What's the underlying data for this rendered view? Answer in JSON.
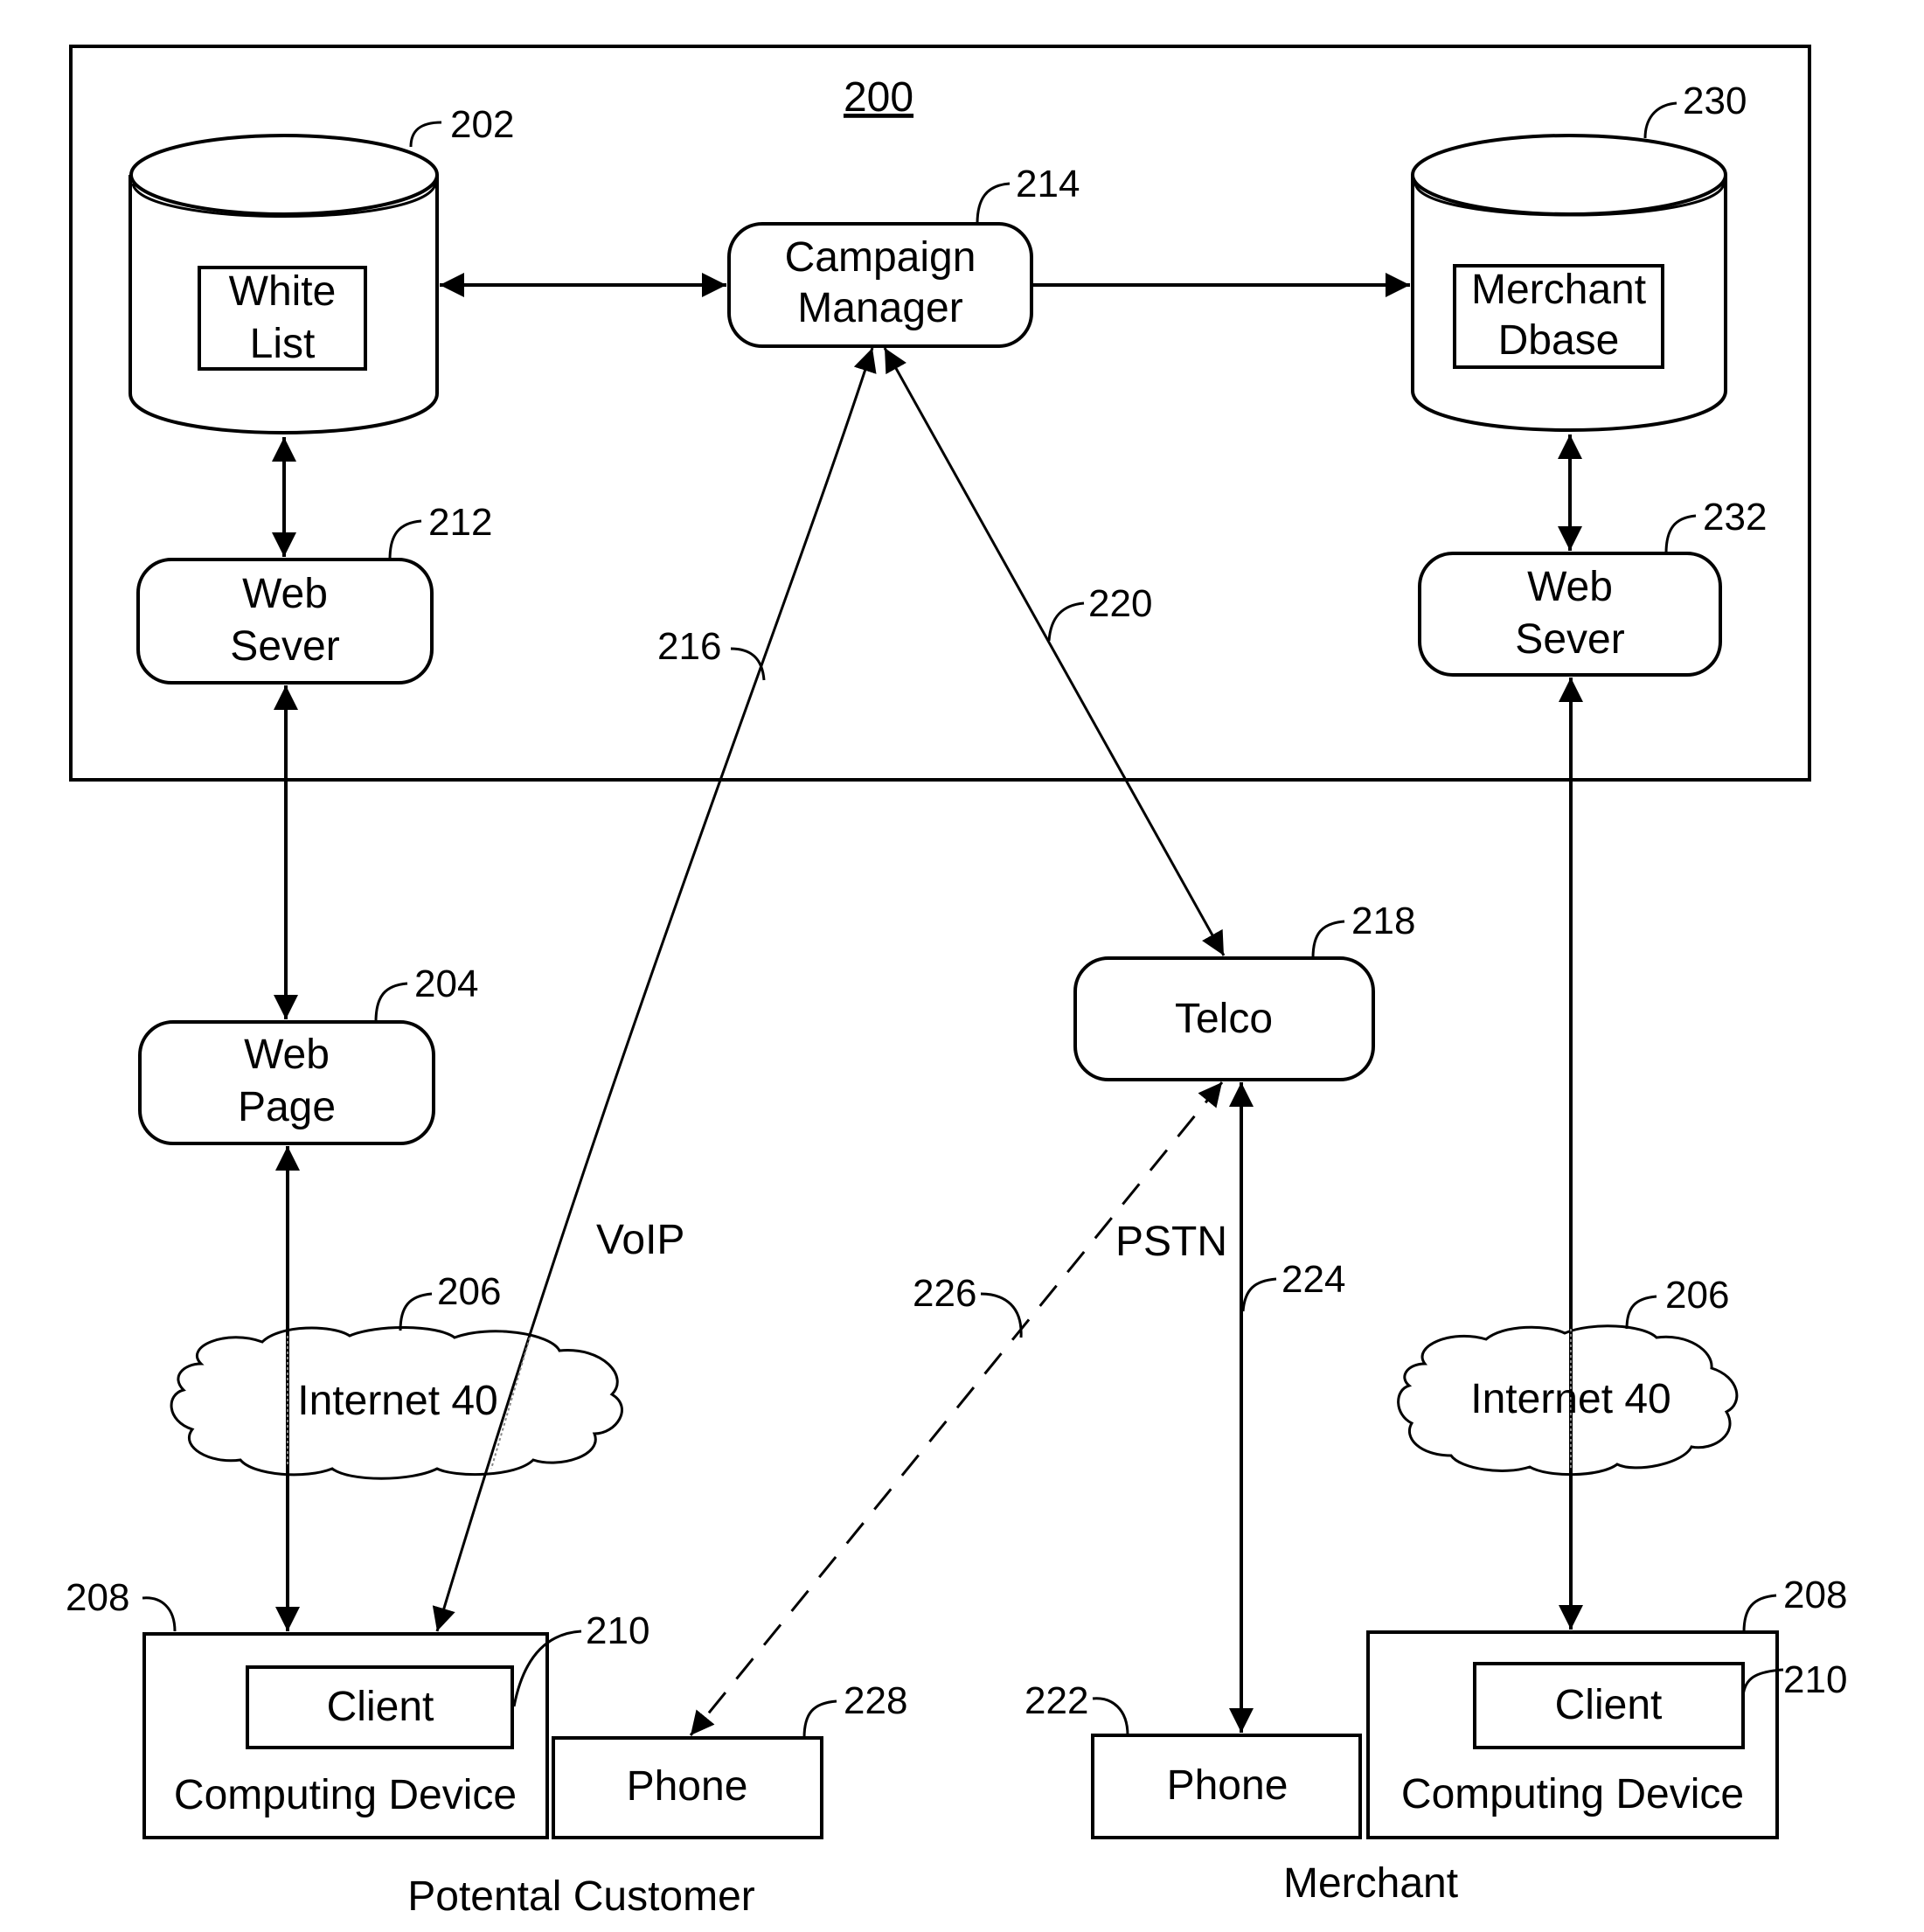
{
  "figure": {
    "system_label": "200",
    "nodes": {
      "white_list_db": {
        "label_lines": [
          "White",
          "List"
        ],
        "ref": "202"
      },
      "campaign_manager": {
        "label_lines": [
          "Campaign",
          "Manager"
        ],
        "ref": "214"
      },
      "merchant_db": {
        "label_lines": [
          "Merchant",
          "Dbase"
        ],
        "ref": "230"
      },
      "web_server_left": {
        "label_lines": [
          "Web",
          "Sever"
        ],
        "ref": "212"
      },
      "web_server_right": {
        "label_lines": [
          "Web",
          "Sever"
        ],
        "ref": "232"
      },
      "web_page": {
        "label_lines": [
          "Web",
          "Page"
        ],
        "ref": "204"
      },
      "telco": {
        "label": "Telco",
        "ref": "218"
      },
      "internet_left": {
        "label": "Internet 40",
        "ref": "206"
      },
      "internet_right": {
        "label": "Internet 40",
        "ref": "206"
      },
      "computing_device_left": {
        "label": "Computing Device",
        "ref": "208",
        "client_label": "Client",
        "client_ref": "210"
      },
      "computing_device_right": {
        "label": "Computing Device",
        "ref": "208",
        "client_label": "Client",
        "client_ref": "210"
      },
      "phone_customer": {
        "label": "Phone",
        "ref": "228"
      },
      "phone_merchant": {
        "label": "Phone",
        "ref": "222"
      }
    },
    "links": {
      "voip": {
        "label": "VoIP",
        "ref": "216"
      },
      "campaign_to_telco": {
        "ref": "220"
      },
      "pstn": {
        "label": "PSTN",
        "ref": "224"
      },
      "dashed_phone_link": {
        "ref": "226"
      }
    },
    "groups": {
      "customer": "Potental Customer",
      "merchant": "Merchant"
    }
  }
}
